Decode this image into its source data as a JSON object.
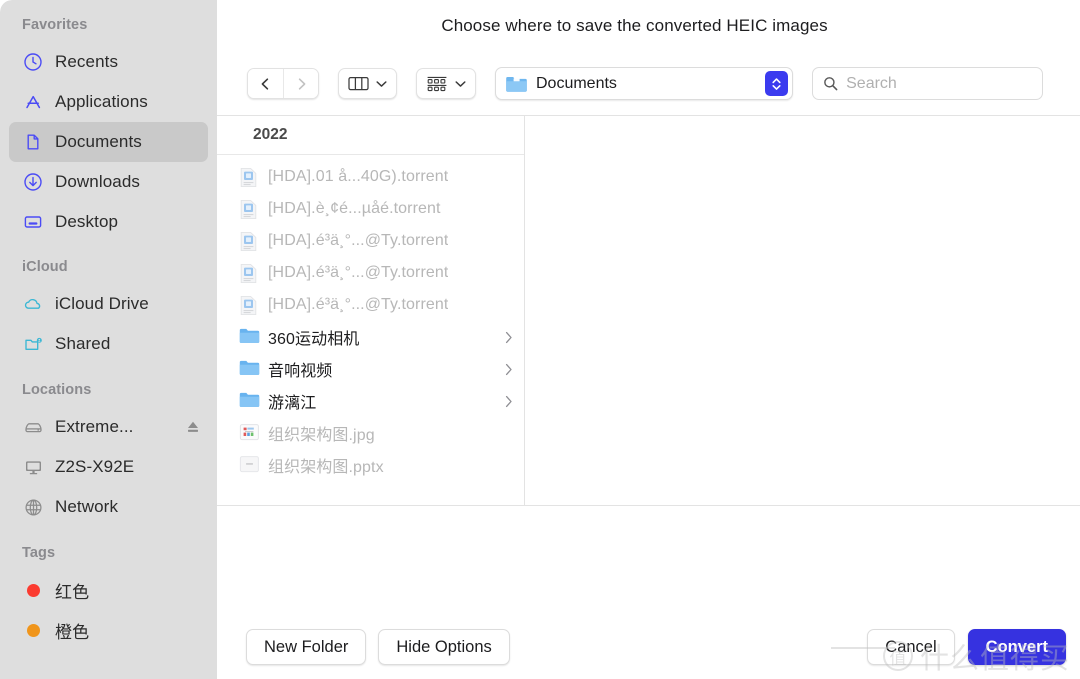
{
  "dialog": {
    "title": "Choose where to save the converted HEIC images"
  },
  "sidebar": {
    "sections": [
      {
        "title": "Favorites",
        "items": [
          {
            "label": "Recents",
            "icon": "clock-icon",
            "selected": false
          },
          {
            "label": "Applications",
            "icon": "applications-icon",
            "selected": false
          },
          {
            "label": "Documents",
            "icon": "document-icon",
            "selected": true
          },
          {
            "label": "Downloads",
            "icon": "download-icon",
            "selected": false
          },
          {
            "label": "Desktop",
            "icon": "desktop-icon",
            "selected": false
          }
        ]
      },
      {
        "title": "iCloud",
        "items": [
          {
            "label": "iCloud Drive",
            "icon": "cloud-icon",
            "selected": false
          },
          {
            "label": "Shared",
            "icon": "shared-folder-icon",
            "selected": false
          }
        ]
      },
      {
        "title": "Locations",
        "items": [
          {
            "label": "Extreme...",
            "icon": "external-drive-icon",
            "selected": false,
            "eject": true
          },
          {
            "label": "Z2S-X92E",
            "icon": "display-icon",
            "selected": false
          },
          {
            "label": "Network",
            "icon": "globe-icon",
            "selected": false
          }
        ]
      },
      {
        "title": "Tags",
        "items": [
          {
            "label": "红色",
            "icon": "tag-dot-icon",
            "color": "#fb3b30",
            "selected": false
          },
          {
            "label": "橙色",
            "icon": "tag-dot-icon",
            "color": "#f0951b",
            "selected": false
          }
        ]
      }
    ]
  },
  "toolbar": {
    "back_icon": "chevron-left-icon",
    "forward_icon": "chevron-right-icon",
    "view_column_icon": "column-view-icon",
    "view_column_chevron": "chevron-down-icon",
    "group_icon": "group-by-icon",
    "group_chevron": "chevron-down-icon",
    "path_icon": "folder-documents-icon",
    "path_label": "Documents",
    "path_stepper_icon": "stepper-up-down-icon",
    "search_icon": "search-icon",
    "search_value": "",
    "search_placeholder": "Search"
  },
  "browser": {
    "column_header": "2022",
    "items": [
      {
        "name": "[HDA].01 å...40G).torrent",
        "type": "file",
        "icon": "torrent-file-icon",
        "dimmed": true
      },
      {
        "name": "[HDA].è¸¢é...µåé.torrent",
        "type": "file",
        "icon": "torrent-file-icon",
        "dimmed": true
      },
      {
        "name": "[HDA].é³ä¸°...@Ty.torrent",
        "type": "file",
        "icon": "torrent-file-icon",
        "dimmed": true
      },
      {
        "name": "[HDA].é³ä¸°...@Ty.torrent",
        "type": "file",
        "icon": "torrent-file-icon",
        "dimmed": true
      },
      {
        "name": "[HDA].é³ä¸°...@Ty.torrent",
        "type": "file",
        "icon": "torrent-file-icon",
        "dimmed": true
      },
      {
        "name": "360运动相机",
        "type": "folder",
        "icon": "folder-icon",
        "dimmed": false
      },
      {
        "name": "音响视频",
        "type": "folder",
        "icon": "folder-icon",
        "dimmed": false
      },
      {
        "name": "游漓江",
        "type": "folder",
        "icon": "folder-icon",
        "dimmed": false
      },
      {
        "name": "组织架构图.jpg",
        "type": "file",
        "icon": "image-file-icon",
        "dimmed": true
      },
      {
        "name": "组织架构图.pptx",
        "type": "file",
        "icon": "pptx-file-icon",
        "dimmed": true
      }
    ]
  },
  "footer": {
    "new_folder_label": "New Folder",
    "hide_options_label": "Hide Options",
    "cancel_label": "Cancel",
    "convert_label": "Convert"
  },
  "watermark": {
    "logo_char": "值",
    "text": "什么值得买"
  },
  "colors": {
    "accent": "#3632e0",
    "sidebar_bg": "#dedede",
    "selected_row": "#c9c9c9",
    "sidebar_icon_blue": "#4b4bf5",
    "sidebar_icon_teal": "#3bb7d4",
    "folder_blue": "#5eb0ef",
    "tag_red": "#fb3b30",
    "tag_orange": "#f0951b"
  }
}
